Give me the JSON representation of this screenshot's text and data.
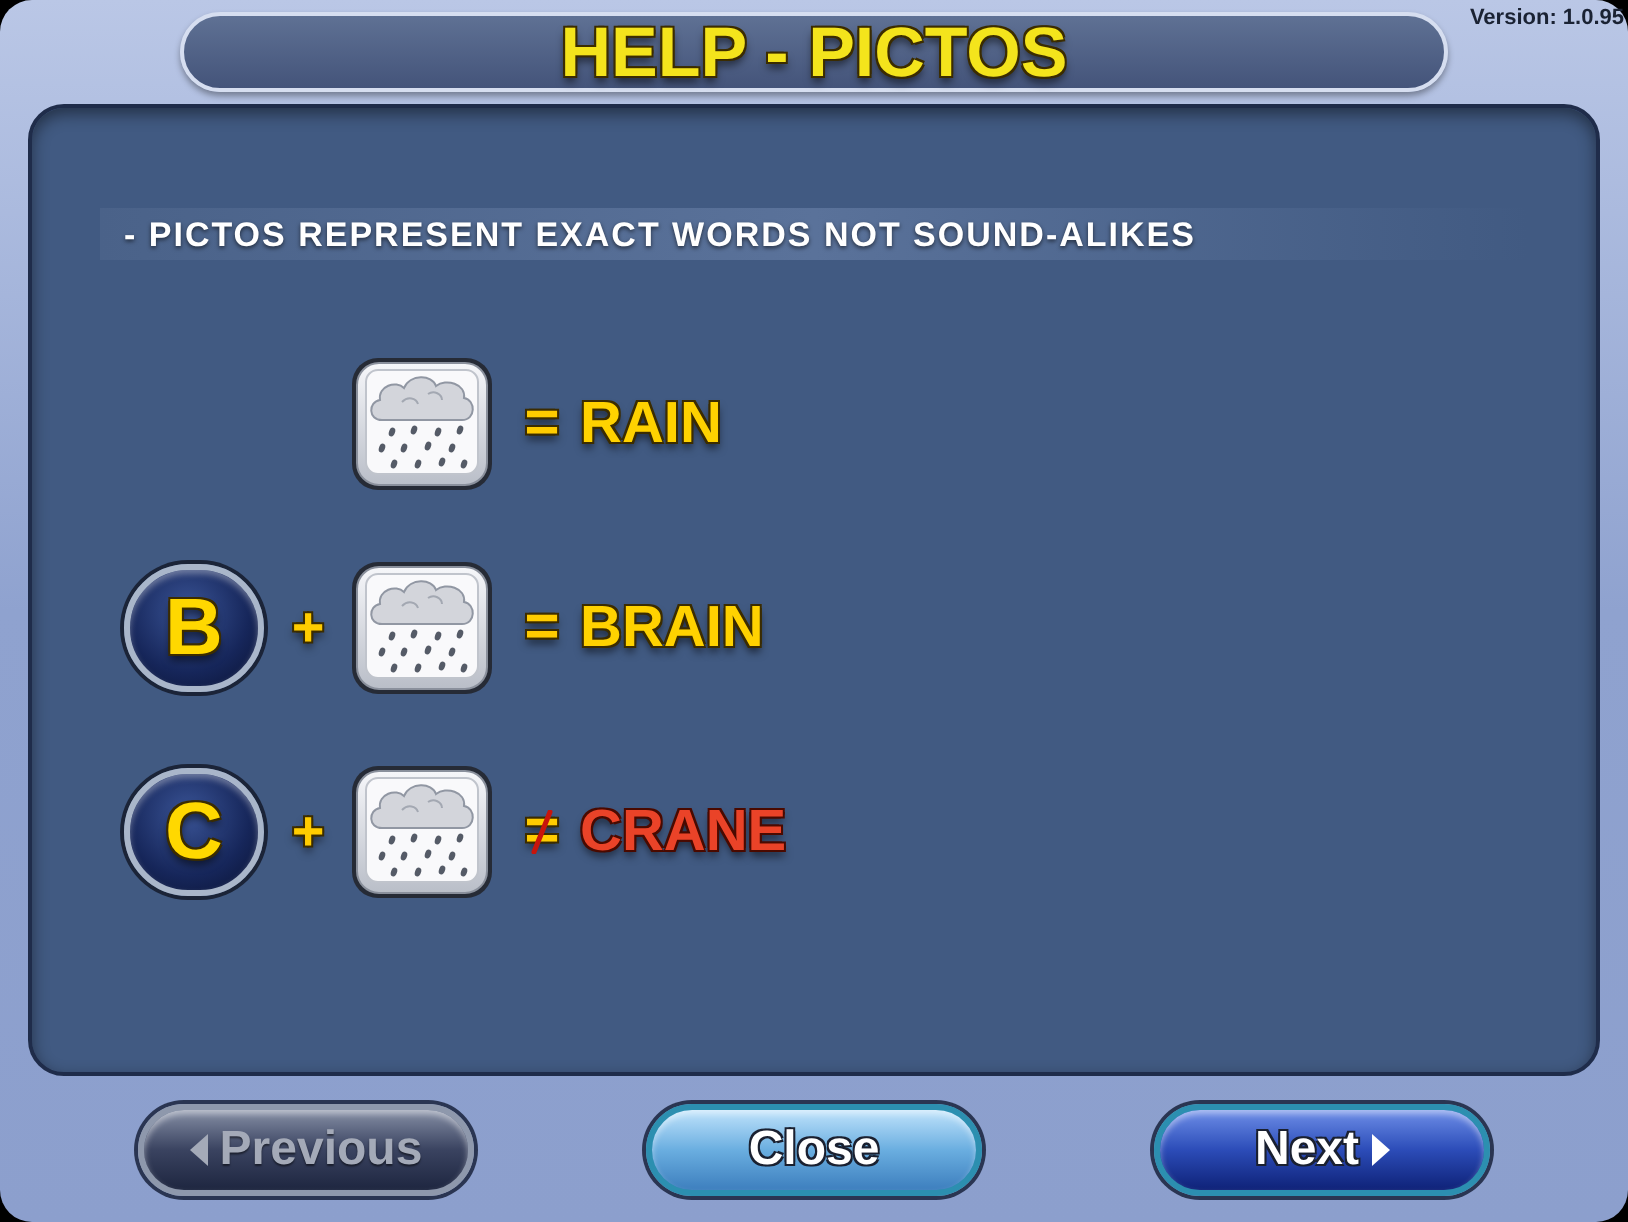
{
  "window": {
    "title": "HELP - PICTOS",
    "version": "Version: 1.0.95"
  },
  "section": {
    "heading": "- PICTOS REPRESENT EXACT WORDS NOT SOUND-ALIKES"
  },
  "equations": [
    {
      "terms": [
        {
          "kind": "picto"
        }
      ],
      "relation": {
        "text": "=",
        "crossed_out": false
      },
      "result": {
        "text": "RAIN",
        "matches": true
      }
    },
    {
      "terms": [
        {
          "kind": "letter",
          "text": "B"
        },
        {
          "kind": "operator",
          "text": "+"
        },
        {
          "kind": "picto"
        }
      ],
      "relation": {
        "text": "=",
        "crossed_out": false
      },
      "result": {
        "text": "BRAIN",
        "matches": true
      }
    },
    {
      "terms": [
        {
          "kind": "letter",
          "text": "C"
        },
        {
          "kind": "operator",
          "text": "+"
        },
        {
          "kind": "picto"
        }
      ],
      "relation": {
        "text": "=",
        "crossed_out": true
      },
      "result": {
        "text": "CRANE",
        "matches": false
      }
    }
  ],
  "buttons": [
    {
      "kind": "back",
      "label": "Previous",
      "disabled": true
    },
    {
      "kind": "close",
      "label": "Close",
      "disabled": false
    },
    {
      "kind": "forward",
      "label": "Next",
      "disabled": false
    }
  ]
}
